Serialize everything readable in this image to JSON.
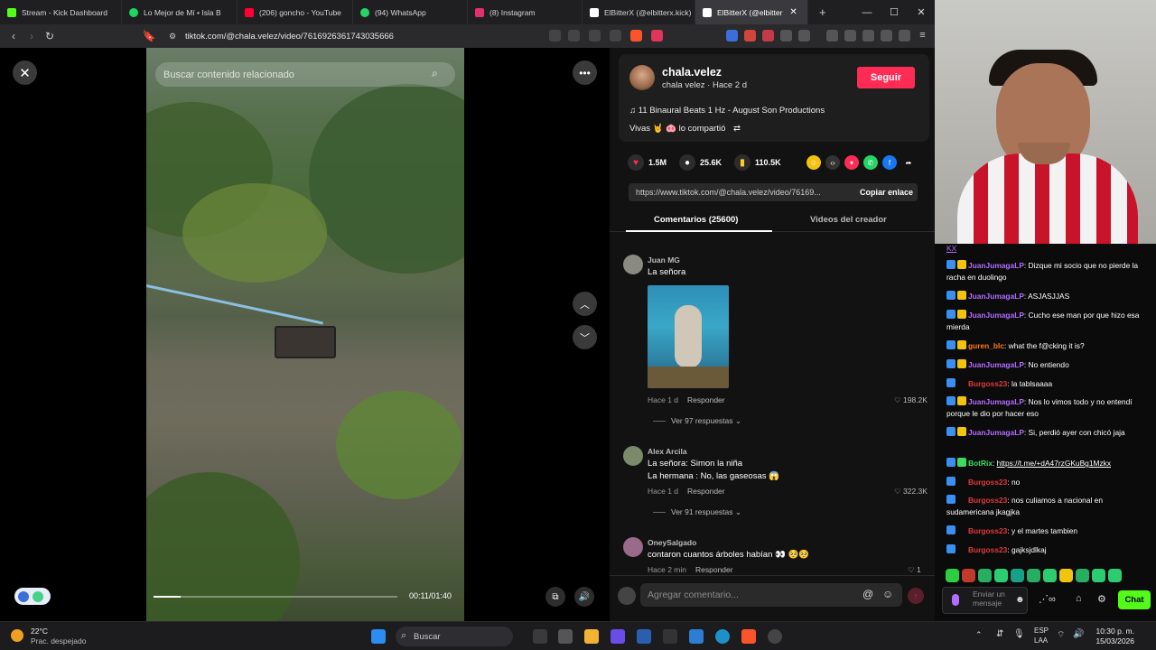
{
  "browser": {
    "tabs": [
      {
        "title": "Stream - Kick Dashboard",
        "color": "#53fc18"
      },
      {
        "title": "Lo Mejor de Mí • Isla B",
        "color": "#1ed760"
      },
      {
        "title": "(206) goncho - YouTube",
        "color": "#ff0033"
      },
      {
        "title": "(94) WhatsApp",
        "color": "#25d366"
      },
      {
        "title": "(8) Instagram",
        "color": "#e1306c"
      },
      {
        "title": "ElBitterX (@elbitterx.kick)",
        "color": "#ffffff"
      },
      {
        "title": "ElBitterX (@elbitter",
        "color": "#ffffff"
      }
    ],
    "url": "tiktok.com/@chala.velez/video/7616926361743035666"
  },
  "tiktok": {
    "search_placeholder": "Buscar contenido relacionado",
    "progress": 0.11,
    "time": "00:11/01:40",
    "author": {
      "handle": "chala.velez",
      "sub": "chala velez · Hace 2 d"
    },
    "follow_label": "Seguir",
    "music": "11 Binaural Beats 1 Hz - August Son Productions",
    "shared": "Vivas 🤘 🐽 lo compartió",
    "stats": {
      "likes": "1.5M",
      "comments": "25.6K",
      "saves": "110.5K"
    },
    "link": "https://www.tiktok.com/@chala.velez/video/76169...",
    "copy_link": "Copiar enlace",
    "tabs": {
      "comments": "Comentarios (25600)",
      "creator": "Videos del creador"
    },
    "comments": [
      {
        "user": "Juan MG",
        "text": "La señora",
        "meta": "Hace 1 d",
        "reply": "Responder",
        "likes": "198.2K",
        "more": "Ver 97 respuestas"
      },
      {
        "user": "Alex Arcila",
        "text": "La señora: Simon la niña",
        "text2": "La hermana : No, las gaseosas 😱",
        "meta": "Hace 1 d",
        "reply": "Responder",
        "likes": "322.3K",
        "more": "Ver 91 respuestas"
      },
      {
        "user": "OneySalgado",
        "text": "contaron cuantos árboles habían 👀 🥺🥺",
        "meta": "Hace 2 min",
        "reply": "Responder",
        "likes": "1"
      }
    ],
    "comment_placeholder": "Agregar comentario..."
  },
  "chat": {
    "header_user": "KX",
    "messages": [
      {
        "user": "JuanJumagaLP",
        "color": "purple",
        "text": ": Dizque mi socio que no pierde la racha en duolingo"
      },
      {
        "user": "JuanJumagaLP",
        "color": "purple",
        "text": ": ASJASJJAS"
      },
      {
        "user": "JuanJumagaLP",
        "color": "purple",
        "text": ": Cucho ese man por que hizo esa mierda"
      },
      {
        "user": "guren_blc",
        "color": "orange",
        "text": ": what the f@cking it is?"
      },
      {
        "user": "JuanJumagaLP",
        "color": "purple",
        "text": ": No entiendo"
      },
      {
        "user": "Burgoss23",
        "color": "red",
        "text": ": la tablsaaaa"
      },
      {
        "user": "JuanJumagaLP",
        "color": "purple",
        "text": ": Nos lo vimos todo y no entendí porque le dio por hacer eso"
      },
      {
        "user": "JuanJumagaLP",
        "color": "purple",
        "text": ": Si, perdió ayer con chicó jaja"
      },
      {
        "user": "BotRix",
        "color": "green",
        "text": ": ",
        "link": "https://t.me/+dA47rzGKuBg1Mzkx"
      },
      {
        "user": "Burgoss23",
        "color": "red",
        "text": ": no"
      },
      {
        "user": "Burgoss23",
        "color": "red",
        "text": ": nos culiamos a nacional en sudamericana jkagjka"
      },
      {
        "user": "Burgoss23",
        "color": "red",
        "text": ": y el martes tambien"
      },
      {
        "user": "Burgoss23",
        "color": "red",
        "text": ": gajksjdlkaj"
      }
    ],
    "input_placeholder": "Enviar un mensaje",
    "send_label": "Chat"
  },
  "taskbar": {
    "temp": "22°C",
    "weather": "Prac. despejado",
    "search": "Buscar",
    "lang": "ESP",
    "lang2": "LAA",
    "time": "10:30 p. m.",
    "date": "15/03/2026"
  }
}
